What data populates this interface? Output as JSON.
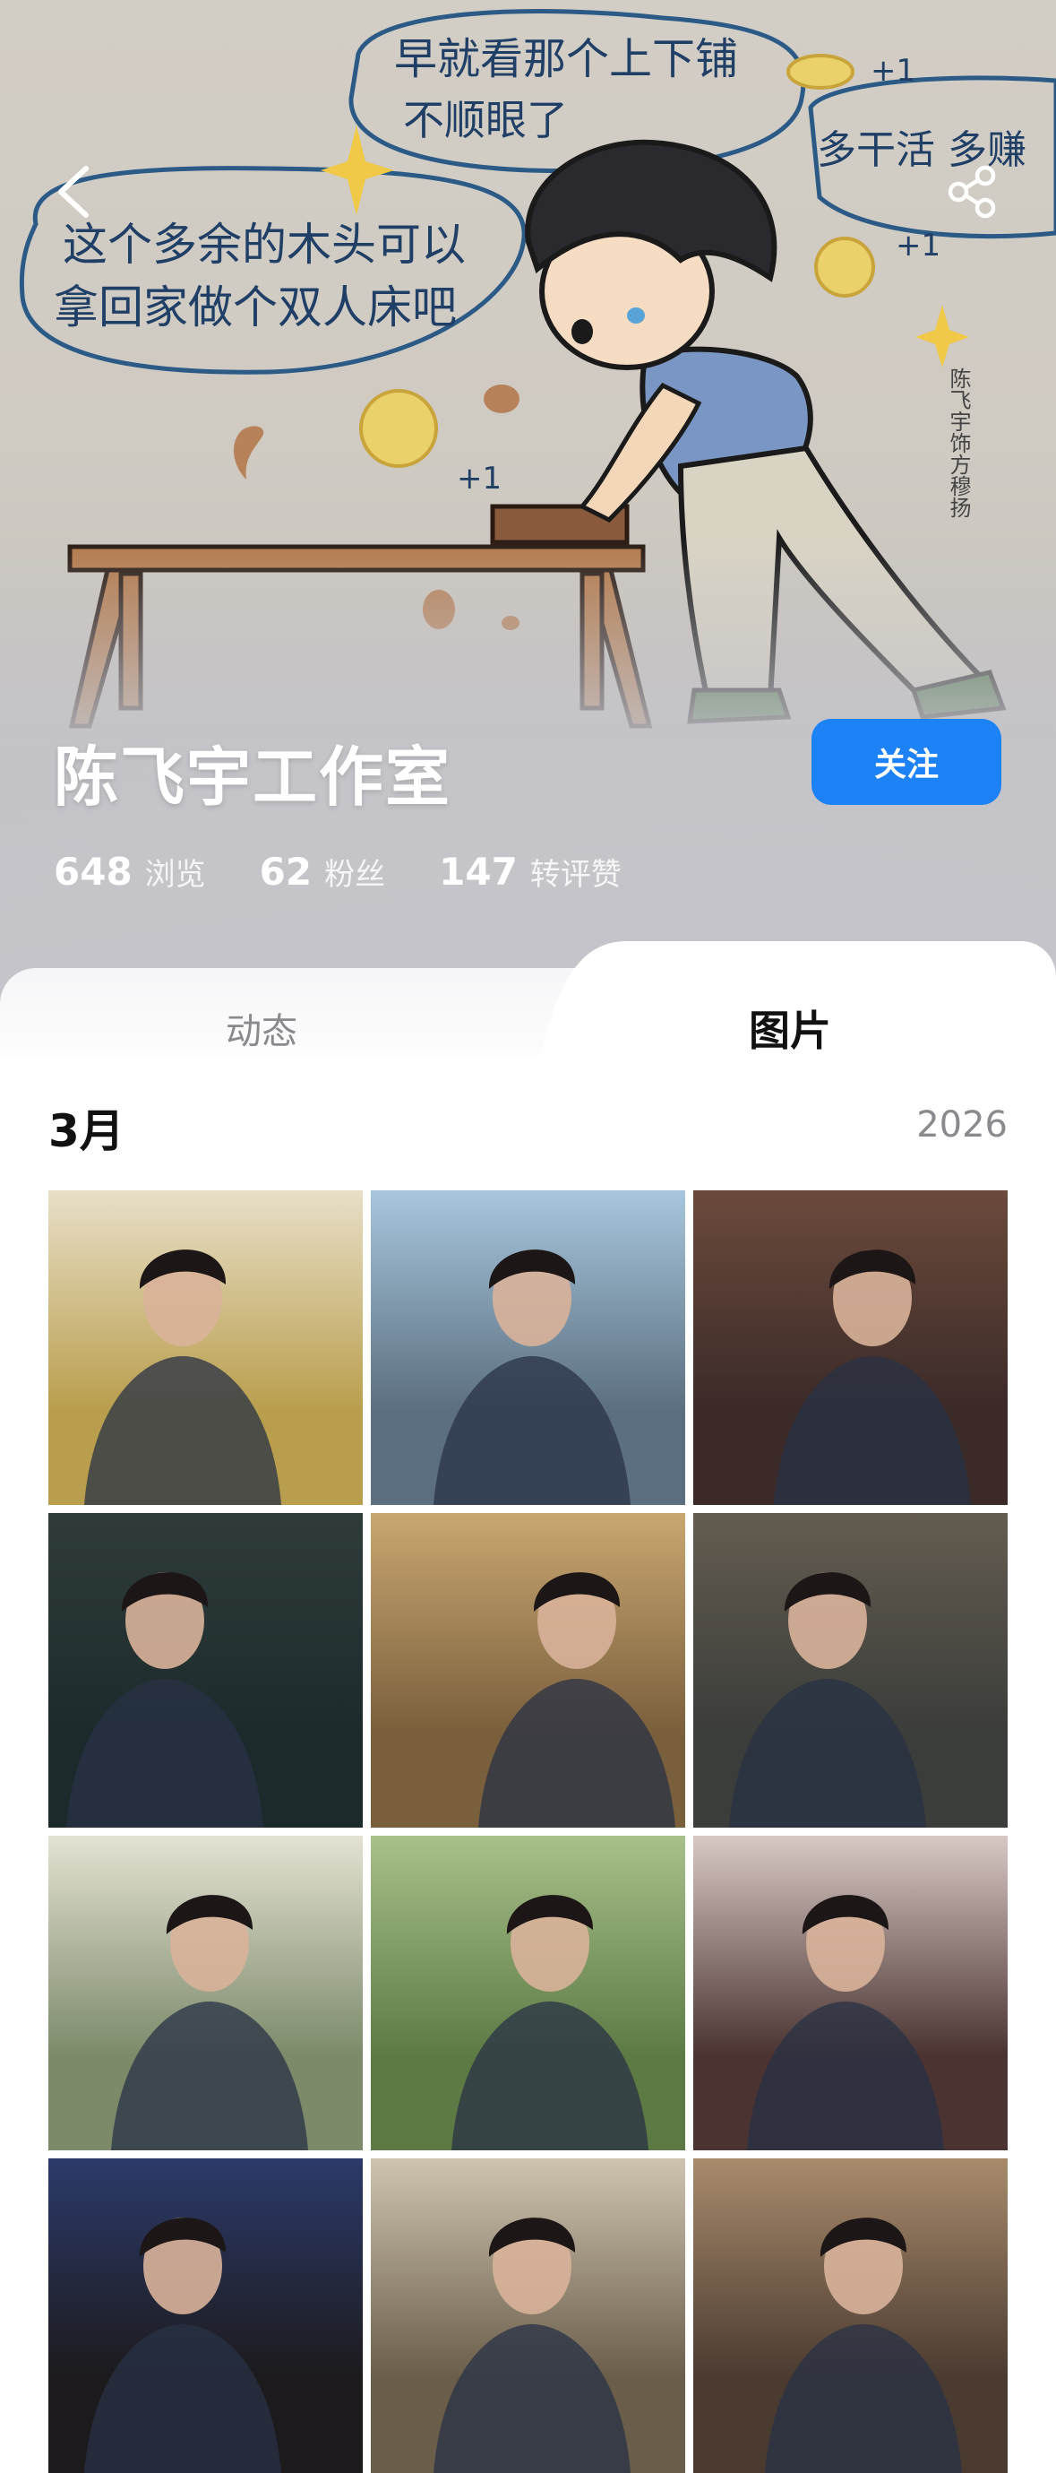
{
  "header": {
    "studio_name": "陈飞宇工作室",
    "follow_label": "关注",
    "illustration": {
      "bubble_left_line1": "这个多余的木头可以",
      "bubble_left_line2": "拿回家做个双人床吧",
      "bubble_top_line1": "早就看那个上下铺",
      "bubble_top_line2": "不顺眼了",
      "bubble_right": "多干活 多赚",
      "signature": "陈飞宇饰方穆扬",
      "plus_one": "+1"
    },
    "stats": [
      {
        "num": "648",
        "label": "浏览"
      },
      {
        "num": "62",
        "label": "粉丝"
      },
      {
        "num": "147",
        "label": "转评赞"
      }
    ]
  },
  "tabs": [
    {
      "label": "动态",
      "active": false
    },
    {
      "label": "图片",
      "active": true
    }
  ],
  "gallery": {
    "month": "3月",
    "year": "2026",
    "photos": [
      {
        "name": "photo-field",
        "bg": "#b99e4d",
        "top": "#e8dfc8"
      },
      {
        "name": "photo-window",
        "bg": "#5c6f80",
        "top": "#a7c6dd"
      },
      {
        "name": "photo-smile",
        "bg": "#3b2a28",
        "top": "#6b4a3c"
      },
      {
        "name": "photo-dark-portrait",
        "bg": "#1d2a2c",
        "top": "#2f3c3a"
      },
      {
        "name": "photo-workbench",
        "bg": "#7a5f3c",
        "top": "#c9a771"
      },
      {
        "name": "photo-painted-face",
        "bg": "#3b3d3a",
        "top": "#645c50"
      },
      {
        "name": "photo-window-light",
        "bg": "#7c8a6a",
        "top": "#e4e2d3"
      },
      {
        "name": "photo-garden",
        "bg": "#5d7a45",
        "top": "#a8c08a"
      },
      {
        "name": "photo-circuit",
        "bg": "#4a3330",
        "top": "#d8c8c4"
      },
      {
        "name": "photo-blue-door",
        "bg": "#1c1a1c",
        "top": "#2c3a6a"
      },
      {
        "name": "photo-map",
        "bg": "#6a5e4a",
        "top": "#cfc4b0"
      },
      {
        "name": "photo-laundry",
        "bg": "#4a3a30",
        "top": "#a88b6c"
      }
    ]
  }
}
